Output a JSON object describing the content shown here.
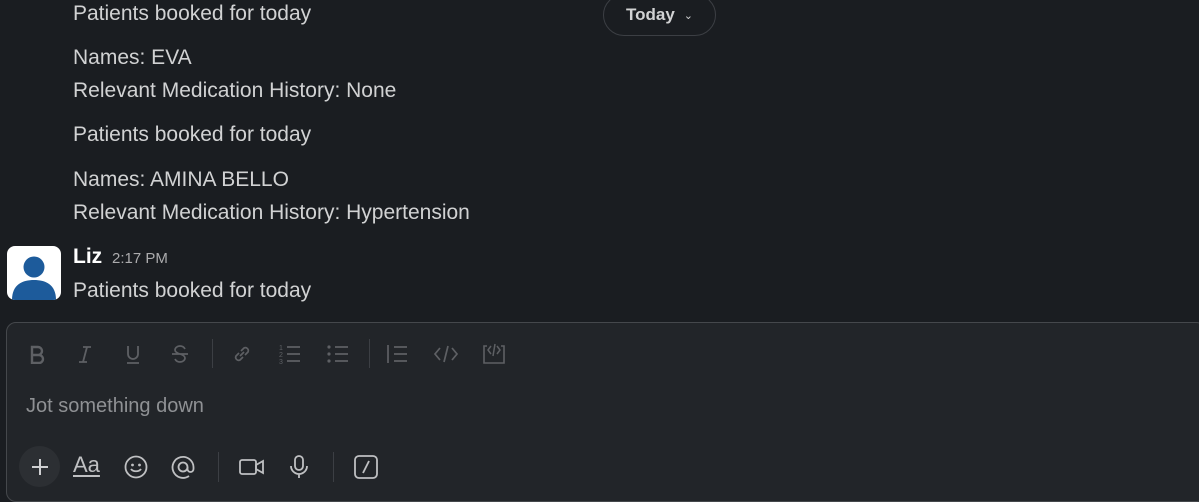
{
  "date_divider": {
    "label": "Today"
  },
  "messages": [
    {
      "text": "Patients booked for today"
    },
    {
      "text": "Names: EVA"
    },
    {
      "text": "Relevant Medication History: None"
    },
    {
      "text": "Patients booked for today"
    },
    {
      "text": "Names: AMINA BELLO"
    },
    {
      "text": "Relevant Medication History: Hypertension"
    }
  ],
  "last_message": {
    "author": "Liz",
    "timestamp": "2:17 PM",
    "text": "Patients booked for today"
  },
  "composer": {
    "placeholder": "Jot something down",
    "format_toolbar": [
      "bold-icon",
      "italic-icon",
      "underline-icon",
      "strikethrough-icon",
      "link-icon",
      "ordered-list-icon",
      "bulleted-list-icon",
      "blockquote-icon",
      "code-icon",
      "code-block-icon"
    ],
    "action_toolbar": [
      "plus-icon",
      "formatting-icon",
      "emoji-icon",
      "mention-icon",
      "video-icon",
      "microphone-icon",
      "slash-command-icon"
    ],
    "formatting_label": "Aa"
  },
  "colors": {
    "background": "#1a1d21",
    "composer_bg": "#222529",
    "text": "#d1d2d3",
    "muted": "#ababad",
    "avatar_blue": "#1d5b9b"
  }
}
